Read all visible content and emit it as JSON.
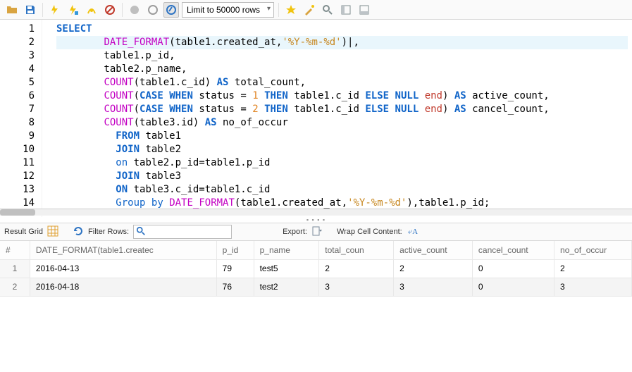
{
  "toolbar": {
    "limit_options": [
      "Limit to 50000 rows"
    ],
    "limit_selected": "Limit to 50000 rows"
  },
  "editor": {
    "lines": [
      {
        "n": 1,
        "html": "<span class='kw-blue'>SELECT</span>"
      },
      {
        "n": 2,
        "html": "        <span class='func'>DATE_FORMAT</span>(table1.created_at,<span class='str'>'%Y-%m-%d'</span>)|,",
        "hl": true
      },
      {
        "n": 3,
        "html": "        table1.p_id,"
      },
      {
        "n": 4,
        "html": "        table2.p_name,"
      },
      {
        "n": 5,
        "html": "        <span class='func'>COUNT</span>(table1.c_id) <span class='kw-blue'>AS</span> total_count,"
      },
      {
        "n": 6,
        "html": "        <span class='func'>COUNT</span>(<span class='kw-blue'>CASE</span> <span class='kw-blue'>WHEN</span> status = <span class='num'>1</span> <span class='kw-blue'>THEN</span> table1.c_id <span class='kw-blue'>ELSE</span> <span class='kw-blue'>NULL</span> <span class='word-end'>end</span>) <span class='kw-blue'>AS</span> active_count,"
      },
      {
        "n": 7,
        "html": "        <span class='func'>COUNT</span>(<span class='kw-blue'>CASE</span> <span class='kw-blue'>WHEN</span> status = <span class='num'>2</span> <span class='kw-blue'>THEN</span> table1.c_id <span class='kw-blue'>ELSE</span> <span class='kw-blue'>NULL</span> <span class='word-end'>end</span>) <span class='kw-blue'>AS</span> cancel_count,"
      },
      {
        "n": 8,
        "html": "        <span class='func'>COUNT</span>(table3.id) <span class='kw-blue'>AS</span> no_of_occur"
      },
      {
        "n": 9,
        "html": "          <span class='kw-blue'>FROM</span> table1"
      },
      {
        "n": 10,
        "html": "          <span class='kw-blue'>JOIN</span> table2"
      },
      {
        "n": 11,
        "html": "          <span class='kw-blue-nl'>on</span> table2.p_id=table1.p_id"
      },
      {
        "n": 12,
        "html": "          <span class='kw-blue'>JOIN</span> table3"
      },
      {
        "n": 13,
        "html": "          <span class='kw-blue'>ON</span> table3.c_id=table1.c_id"
      },
      {
        "n": 14,
        "html": "          <span class='kw-blue-nl'>Group</span> <span class='kw-blue-nl'>by</span> <span class='func'>DATE_FORMAT</span>(table1.created_at,<span class='str'>'%Y-%m-%d'</span>),table1.p_id;"
      }
    ]
  },
  "results_bar": {
    "label_grid": "Result Grid",
    "label_filter": "Filter Rows:",
    "filter_value": "",
    "label_export": "Export:",
    "label_wrap": "Wrap Cell Content:"
  },
  "results": {
    "columns": [
      "#",
      "DATE_FORMAT(table1.createc",
      "p_id",
      "p_name",
      "total_coun",
      "active_count",
      "cancel_count",
      "no_of_occur"
    ],
    "rows": [
      [
        "1",
        "2016-04-13",
        "79",
        "test5",
        "2",
        "2",
        "0",
        "2"
      ],
      [
        "2",
        "2016-04-18",
        "76",
        "test2",
        "3",
        "3",
        "0",
        "3"
      ]
    ]
  }
}
